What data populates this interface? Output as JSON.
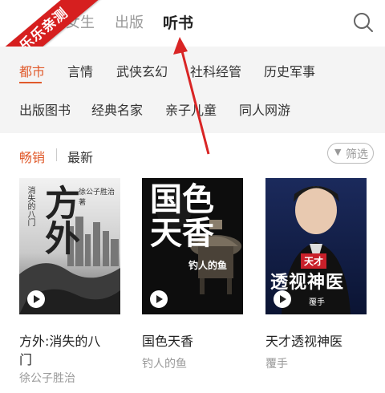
{
  "ribbon": {
    "text": "乐乐亲测"
  },
  "tabs": [
    {
      "label": "女生"
    },
    {
      "label": "出版"
    },
    {
      "label": "听书"
    }
  ],
  "categories": {
    "row1": [
      "都市",
      "言情",
      "武侠玄幻",
      "社科经管",
      "历史军事"
    ],
    "row2": [
      "出版图书",
      "经典名家",
      "亲子儿童",
      "同人网游"
    ]
  },
  "sort": {
    "bestseller": "畅销",
    "latest": "最新",
    "filter": "筛选"
  },
  "books": [
    {
      "title": "方外:消失的八门",
      "title_line1": "方外:消失的八",
      "title_line2": "门",
      "author": "徐公子胜治",
      "cover_text_big": "方外",
      "cover_text_small": "徐公子胜治 著",
      "cover_text_side": "消失的八门"
    },
    {
      "title": "国色天香",
      "author": "钓人的鱼",
      "cover_text_big": "国色天香",
      "cover_text_small": "钓人的鱼"
    },
    {
      "title": "天才透视神医",
      "author": "覆手",
      "cover_text_tag": "天才",
      "cover_text_big": "透视神医",
      "cover_text_small": "覆手"
    }
  ],
  "colors": {
    "accent": "#e05a2b",
    "ribbon": "#d61f1f",
    "arrow": "#d92525"
  }
}
